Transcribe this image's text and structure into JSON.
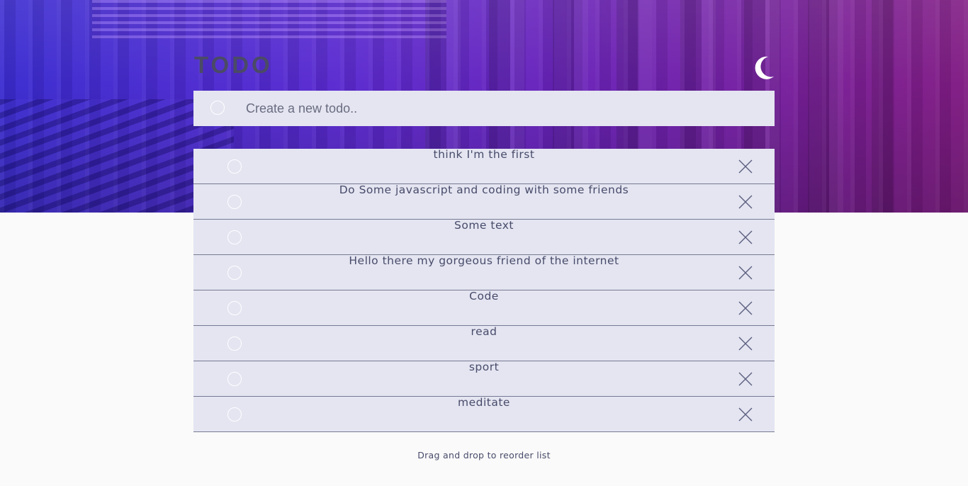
{
  "app": {
    "title": "TODO"
  },
  "theme_toggle": {
    "icon": "moon-icon"
  },
  "new_todo": {
    "placeholder": "Create a new todo..",
    "value": ""
  },
  "todos": [
    {
      "text": "think I'm the first",
      "completed": false
    },
    {
      "text": "Do Some javascript and coding with some friends",
      "completed": false
    },
    {
      "text": "Some text",
      "completed": false
    },
    {
      "text": "Hello there my gorgeous friend of the internet",
      "completed": false
    },
    {
      "text": "Code",
      "completed": false
    },
    {
      "text": "read",
      "completed": false
    },
    {
      "text": "sport",
      "completed": false
    },
    {
      "text": "meditate",
      "completed": false
    }
  ],
  "footer": {
    "hint": "Drag and drop to reorder list"
  },
  "colors": {
    "hero_gradient_start": "#3a2bd0",
    "hero_gradient_end": "#811c84",
    "card_background": "#e4e5f1",
    "text": "#484b6a",
    "page_background": "#fafafa"
  }
}
